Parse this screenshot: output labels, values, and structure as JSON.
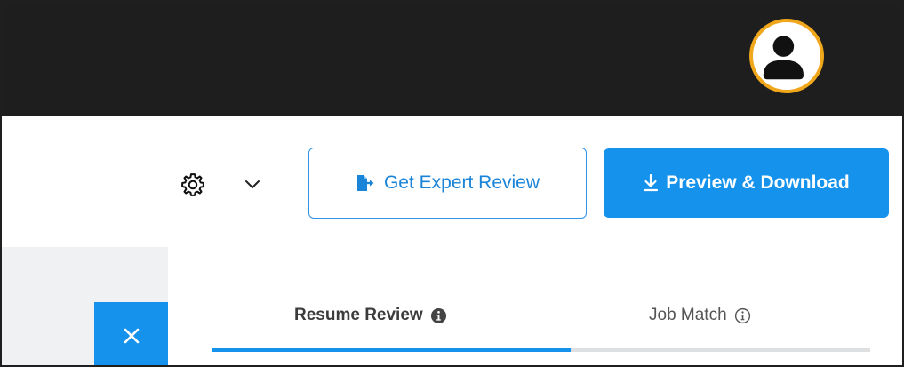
{
  "header": {
    "avatar_icon": "user-avatar-icon",
    "avatar_ring_color": "#f0a71b"
  },
  "toolbar": {
    "settings_icon": "gear-icon",
    "dropdown_icon": "chevron-down-icon",
    "expert_review_label": "Get Expert Review",
    "expert_review_icon": "file-export-icon",
    "download_label": "Preview & Download",
    "download_icon": "download-icon",
    "accent_color": "#1592eb"
  },
  "panel": {
    "close_icon": "close-icon",
    "tabs": [
      {
        "label": "Resume Review",
        "icon": "info-filled-icon",
        "active": true
      },
      {
        "label": "Job Match",
        "icon": "info-outline-icon",
        "active": false
      }
    ]
  }
}
